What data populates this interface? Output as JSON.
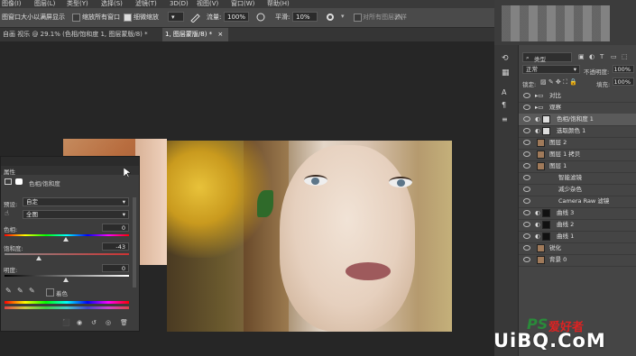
{
  "menubar": {
    "items": [
      "图像(I)",
      "图层(L)",
      "类型(Y)",
      "选择(S)",
      "滤镜(T)",
      "3D(D)",
      "视图(V)",
      "窗口(W)",
      "帮助(H)"
    ]
  },
  "options": {
    "resize_windows": "图窗口大小以满屏显示",
    "zoom_all": "缩放所有窗口",
    "scrubby": "细微缩放",
    "flow_label": "流量:",
    "flow_value": "100%",
    "smoothing_label": "平滑:",
    "smoothing_value": "10%",
    "opacity_value": "100%",
    "sample_label": "对所有图层取样"
  },
  "tabs": [
    {
      "label": "自画 视乐 @ 29.1% (色相/饱和度 1, 图层蒙版/8) *",
      "active": false
    },
    {
      "label": "1, 图层蒙版/8) *",
      "active": true
    }
  ],
  "properties": {
    "title": "属性",
    "adjustment": "色相/饱和度",
    "preset_label": "预设:",
    "preset_value": "自定",
    "channel_value": "全图",
    "hue_label": "色相:",
    "hue_value": "0",
    "saturation_label": "饱和度:",
    "saturation_value": "-43",
    "lightness_label": "明度:",
    "lightness_value": "0",
    "colorize_label": "着色"
  },
  "layers_panel": {
    "kind_label": "类型",
    "blend_mode": "正常",
    "opacity_label": "不透明度:",
    "opacity_value": "100%",
    "lock_label": "锁定:",
    "fill_label": "填充:",
    "fill_value": "100%",
    "layers": [
      {
        "name": "对比",
        "type": "group",
        "selected": false
      },
      {
        "name": "观察",
        "type": "group",
        "selected": false
      },
      {
        "name": "色相/饱和度 1",
        "type": "adjust",
        "selected": true
      },
      {
        "name": "选取颜色 1",
        "type": "adjust",
        "selected": false
      },
      {
        "name": "图层 2",
        "type": "layer",
        "selected": false
      },
      {
        "name": "图层 1 拷贝",
        "type": "layer",
        "selected": false
      },
      {
        "name": "图层 1",
        "type": "layer",
        "selected": false
      },
      {
        "name": "智能滤镜",
        "type": "filter",
        "selected": false
      },
      {
        "name": "减少杂色",
        "type": "filter",
        "selected": false
      },
      {
        "name": "Camera Raw 滤镜",
        "type": "filter",
        "selected": false
      },
      {
        "name": "曲线 3",
        "type": "curve",
        "selected": false
      },
      {
        "name": "曲线 2",
        "type": "curve",
        "selected": false
      },
      {
        "name": "曲线 1",
        "type": "curve",
        "selected": false
      },
      {
        "name": "锐化",
        "type": "layer",
        "selected": false
      },
      {
        "name": "背景 0",
        "type": "layer",
        "selected": false
      }
    ]
  },
  "watermark": {
    "ps_text": "PS",
    "cn_text": "爱好者",
    "site": "UiBQ.CoM"
  },
  "colors": {
    "ui_bg": "#282828",
    "panel": "#3c3c3c",
    "selected": "#5a5a5a"
  }
}
